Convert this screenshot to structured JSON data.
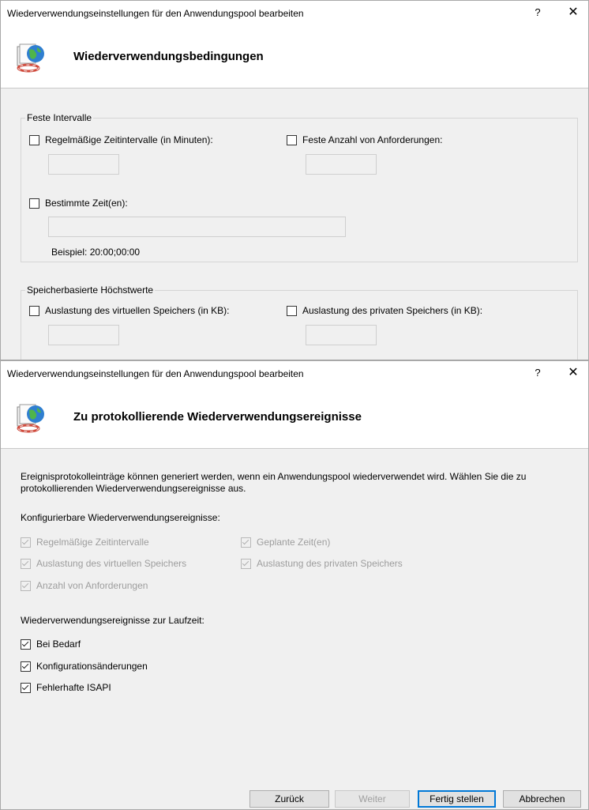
{
  "dialog1": {
    "title": "Wiederverwendungseinstellungen für den Anwendungspool bearbeiten",
    "help": "?",
    "close": "✕",
    "header": "Wiederverwendungsbedingungen",
    "group_fixed": {
      "legend": "Feste Intervalle",
      "regular_intervals": {
        "label": "Regelmäßige Zeitintervalle (in Minuten):",
        "checked": false
      },
      "fixed_requests": {
        "label": "Feste Anzahl von Anforderungen:",
        "checked": false
      },
      "specific_times": {
        "label": "Bestimmte Zeit(en):",
        "checked": false
      },
      "example": "Beispiel: 20:00;00:00"
    },
    "group_memory": {
      "legend": "Speicherbasierte Höchstwerte",
      "virtual_memory": {
        "label": "Auslastung des virtuellen Speichers (in KB):",
        "checked": false
      },
      "private_memory": {
        "label": "Auslastung des privaten Speichers (in KB):",
        "checked": false
      }
    }
  },
  "dialog2": {
    "title": "Wiederverwendungseinstellungen für den Anwendungspool bearbeiten",
    "help": "?",
    "close": "✕",
    "header": "Zu protokollierende Wiederverwendungsereignisse",
    "description": "Ereignisprotokolleinträge können generiert werden, wenn ein Anwendungspool wiederverwendet wird. Wählen Sie die zu protokollierenden Wiederverwendungsereignisse aus.",
    "configurable_heading": "Konfigurierbare Wiederverwendungsereignisse:",
    "configurable": [
      {
        "label": "Regelmäßige Zeitintervalle",
        "checked": true
      },
      {
        "label": "Geplante Zeit(en)",
        "checked": true
      },
      {
        "label": "Auslastung des virtuellen Speichers",
        "checked": true
      },
      {
        "label": "Auslastung des privaten Speichers",
        "checked": true
      },
      {
        "label": "Anzahl von Anforderungen",
        "checked": true
      }
    ],
    "runtime_heading": "Wiederverwendungsereignisse zur Laufzeit:",
    "runtime": [
      {
        "label": "Bei Bedarf",
        "checked": true
      },
      {
        "label": "Konfigurationsänderungen",
        "checked": true
      },
      {
        "label": "Fehlerhafte ISAPI",
        "checked": true
      }
    ],
    "buttons": {
      "back": "Zurück",
      "next": "Weiter",
      "finish": "Fertig stellen",
      "cancel": "Abbrechen"
    }
  }
}
